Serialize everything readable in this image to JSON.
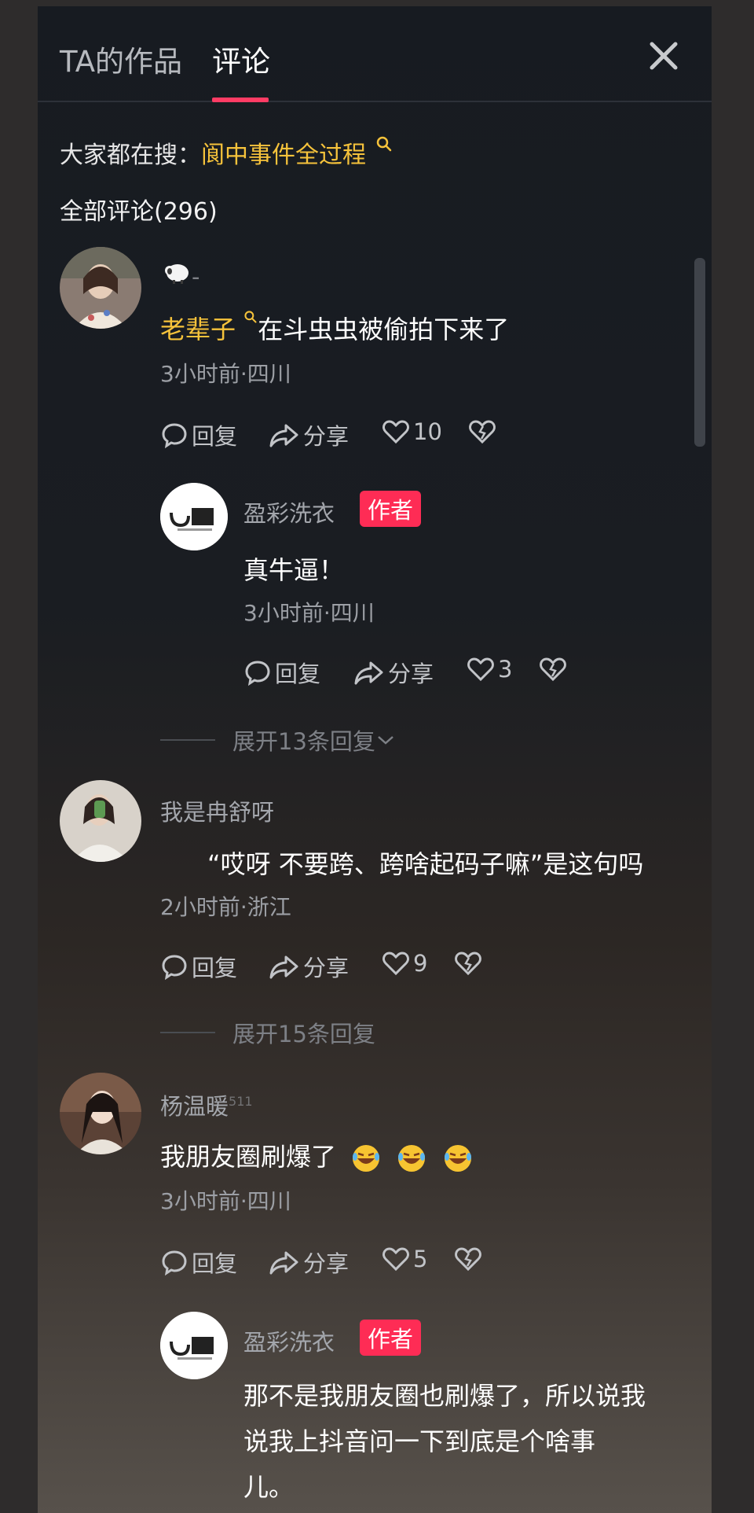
{
  "tabs": [
    {
      "label": "TA的作品",
      "active": false
    },
    {
      "label": "评论",
      "active": true
    }
  ],
  "search": {
    "prefix": "大家都在搜：",
    "keyword": "阆中事件全过程"
  },
  "comments_header": "全部评论(296)",
  "comments": [
    {
      "username": "",
      "highlight": "老辈子",
      "text": "在斗虫虫被偷拍下来了",
      "meta": "3小时前·四川",
      "reply_label": "回复",
      "share_label": "分享",
      "likes": "10",
      "reply": {
        "username": "盈彩洗衣",
        "badge": "作者",
        "text": "真牛逼！",
        "meta": "3小时前·四川",
        "reply_label": "回复",
        "share_label": "分享",
        "likes": "3"
      },
      "expand": "展开13条回复"
    },
    {
      "username": "我是冉舒呀",
      "text": "“哎呀 不要跨、跨啥起码子嘛”是这句吗",
      "meta": "2小时前·浙江",
      "reply_label": "回复",
      "share_label": "分享",
      "likes": "9",
      "expand": "展开15条回复"
    },
    {
      "username": "杨温暖",
      "text": "我朋友圈刷爆了",
      "meta": "3小时前·四川",
      "reply_label": "回复",
      "share_label": "分享",
      "likes": "5",
      "reply": {
        "username": "盈彩洗衣",
        "badge": "作者",
        "text_lines": [
          "那不是我朋友圈也刷爆了，所以说我",
          "说我上抖音问一下到底是个啥事",
          "儿。"
        ]
      }
    }
  ],
  "colors": {
    "accent": "#fe2c55",
    "highlight": "#f6c33b"
  }
}
